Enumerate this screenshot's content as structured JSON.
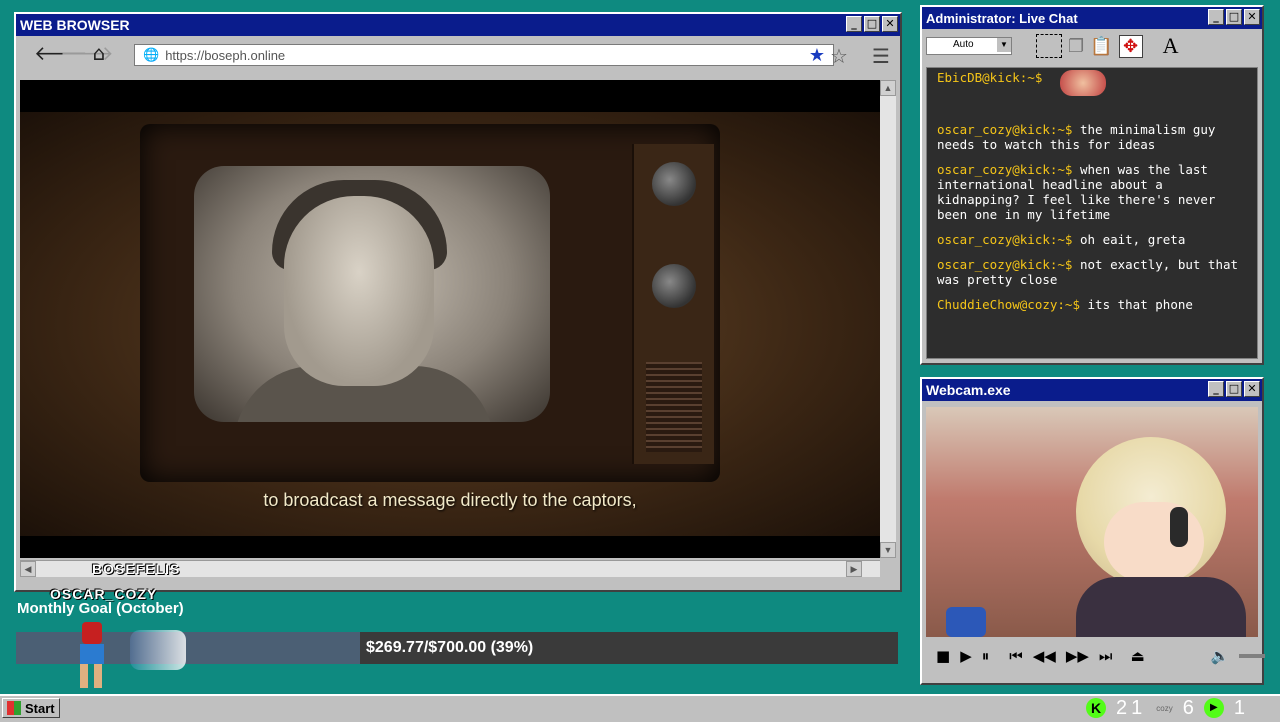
{
  "browser": {
    "title": "WEB BROWSER",
    "url": "https://boseph.online",
    "subtitle": "to broadcast a message directly to the captors,"
  },
  "chat": {
    "title": "Administrator: Live Chat",
    "font_select": "Auto",
    "messages": [
      {
        "user": "EbicDB@kick:~$",
        "text": ""
      },
      {
        "user": "oscar_cozy@kick:~$",
        "text": "the minimalism guy needs to watch this for ideas"
      },
      {
        "user": "oscar_cozy@kick:~$",
        "text": "when was the last international headline about a kidnapping? I feel like there's never been one in my lifetime"
      },
      {
        "user": "oscar_cozy@kick:~$",
        "text": "oh eait, greta"
      },
      {
        "user": "oscar_cozy@kick:~$",
        "text": "not exactly, but that was pretty close"
      },
      {
        "user": "ChuddieChow@cozy:~$",
        "text": "its that phone"
      }
    ]
  },
  "webcam": {
    "title": "Webcam.exe"
  },
  "overlay": {
    "name1": "BOSEFELIS",
    "name2": "OSCAR_COZY",
    "goal_label": "Monthly Goal (October)",
    "goal_text": "$269.77/$700.00 (39%)",
    "goal_progress": 0.39
  },
  "taskbar": {
    "start": "Start",
    "count1": "21",
    "count2": "6",
    "count3": "1"
  },
  "colors": {
    "desktop": "#0e8a80",
    "titlebar": "#0a1c8c",
    "chat_user": "#f5c518",
    "kick_green": "#53fc18"
  }
}
